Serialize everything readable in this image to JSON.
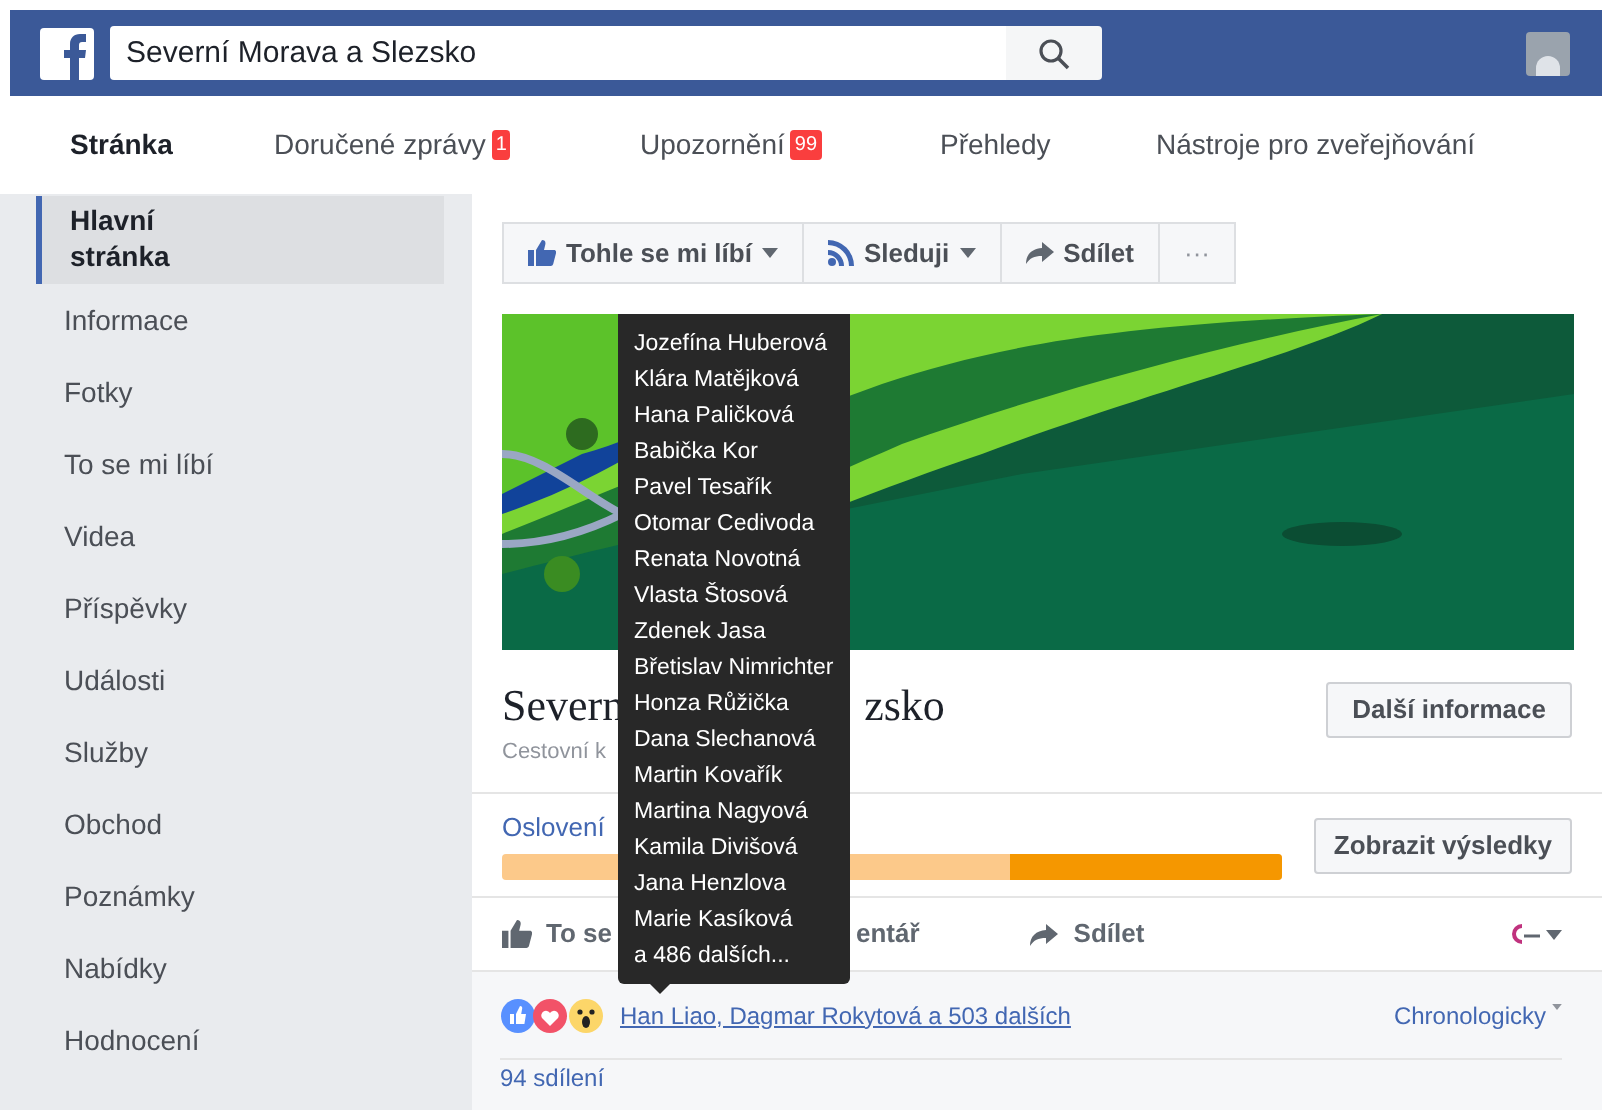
{
  "header": {
    "search": {
      "value": "Severní Morava a Slezsko"
    }
  },
  "tabs": [
    {
      "label": "Stránka",
      "selected": true
    },
    {
      "label": "Doručené zprávy",
      "selected": false,
      "badge": "1"
    },
    {
      "label": "Upozornění",
      "selected": false,
      "badge": "99"
    },
    {
      "label": "Přehledy",
      "selected": false
    },
    {
      "label": "Nástroje pro zveřejňování",
      "selected": false
    }
  ],
  "sidebar": {
    "items": [
      {
        "label": "Hlavní stránka",
        "selected": true
      },
      {
        "label": "Informace",
        "selected": false
      },
      {
        "label": "Fotky",
        "selected": false
      },
      {
        "label": "To se mi líbí",
        "selected": false
      },
      {
        "label": "Videa",
        "selected": false
      },
      {
        "label": "Příspěvky",
        "selected": false
      },
      {
        "label": "Události",
        "selected": false
      },
      {
        "label": "Služby",
        "selected": false
      },
      {
        "label": "Obchod",
        "selected": false
      },
      {
        "label": "Poznámky",
        "selected": false
      },
      {
        "label": "Nabídky",
        "selected": false
      },
      {
        "label": "Hodnocení",
        "selected": false
      }
    ]
  },
  "page_actions": [
    {
      "label": "Tohle se mi líbí",
      "kind": "like"
    },
    {
      "label": "Sleduji",
      "kind": "follow"
    },
    {
      "label": "Sdílet",
      "kind": "share"
    },
    {
      "label": "···",
      "kind": "more"
    }
  ],
  "page_title": {
    "visible_start": "Severn",
    "visible_end": "zsko",
    "category_visible": "Cestovní k",
    "more_info_button": "Další informace"
  },
  "reach": {
    "label": "Oslovení",
    "level": 0.35,
    "button": "Zobrazit výsledky"
  },
  "post_actions": {
    "like_visible": "To se",
    "comment_visible": "entář",
    "share": "Sdílet"
  },
  "reactions": {
    "link": "Han Liao, Dagmar Rokytová a 503 dalších",
    "sort": "Chronologicky",
    "shares": "94 sdílení"
  },
  "tooltip": {
    "names": [
      "Jozefína Huberová",
      "Klára Matějková",
      "Hana Paličková",
      "Babička Kor",
      "Pavel Tesařík",
      "Otomar Cedivoda",
      "Renata Novotná",
      "Vlasta Štosová",
      "Zdenek Jasa",
      "Břetislav Nimrichter",
      "Honza Růžička",
      "Dana Slechanová",
      "Martin Kovařík",
      "Martina Nagyová",
      "Kamila Divišová",
      "Jana Henzlova",
      "Marie Kasíková"
    ],
    "more": "a 486 dalších..."
  }
}
